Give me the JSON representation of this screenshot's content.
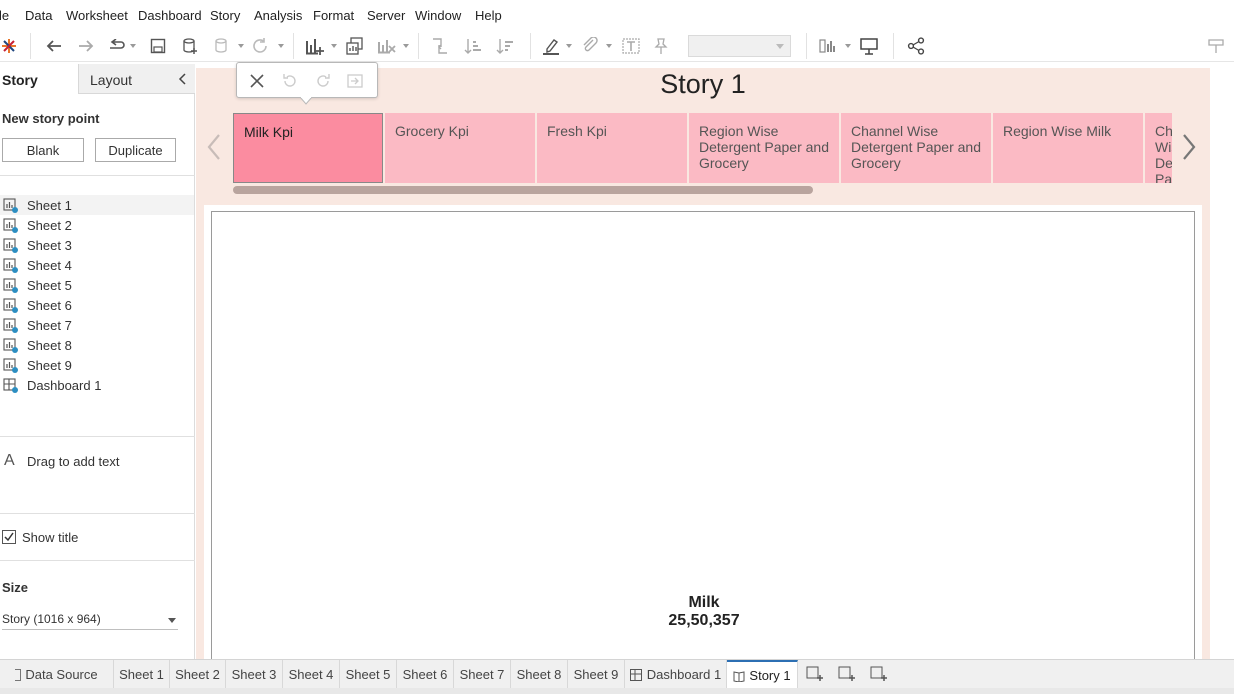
{
  "menu": [
    "le",
    "Data",
    "Worksheet",
    "Dashboard",
    "Story",
    "Analysis",
    "Format",
    "Server",
    "Window",
    "Help"
  ],
  "left_pane": {
    "tab_story": "Story",
    "tab_layout": "Layout",
    "new_story_point_title": "New story point",
    "blank_button": "Blank",
    "duplicate_button": "Duplicate",
    "sheets": [
      "Sheet 1",
      "Sheet 2",
      "Sheet 3",
      "Sheet 4",
      "Sheet 5",
      "Sheet 6",
      "Sheet 7",
      "Sheet 8",
      "Sheet 9",
      "Dashboard 1"
    ],
    "drag_text": "Drag to add text",
    "show_title_label": "Show title",
    "show_title_checked": true,
    "size_title": "Size",
    "size_value": "Story (1016 x 964)"
  },
  "story": {
    "title": "Story 1",
    "points": [
      "Milk Kpi",
      "Grocery Kpi",
      "Fresh Kpi",
      "Region Wise Detergent Paper and Grocery",
      "Channel Wise Detergent Paper and Grocery",
      "Region Wise Milk",
      "Channel Wise Detergent Paper and Fro"
    ],
    "active_point": "Milk Kpi",
    "kpi": {
      "label": "Milk",
      "value": "25,50,357"
    }
  },
  "bottom_tabs": [
    "Data Source",
    "Sheet 1",
    "Sheet 2",
    "Sheet 3",
    "Sheet 4",
    "Sheet 5",
    "Sheet 6",
    "Sheet 7",
    "Sheet 8",
    "Sheet 9",
    "Dashboard 1",
    "Story 1"
  ],
  "active_bottom_tab": "Story 1",
  "colors": {
    "story_background": "#f9e8e1",
    "story_point": "#fbbac4",
    "story_point_active": "#fb8ca0",
    "active_tab_accent": "#2c6fb3"
  }
}
